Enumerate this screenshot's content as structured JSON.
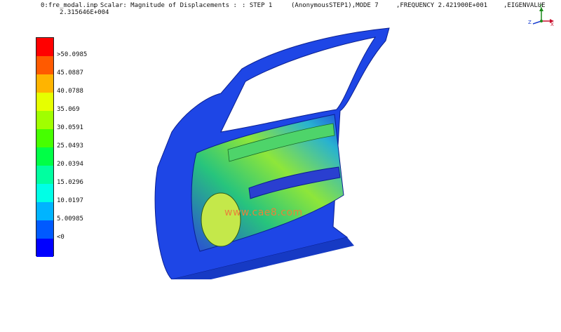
{
  "header": {
    "file": "0:fre_modal.inp",
    "scalar": ": Scalar: Magnitude of Displacements :",
    "step": ": STEP 1",
    "step_name": "(AnonymousSTEP1),MODE 7",
    "frequency": ",FREQUENCY 2.421900E+001",
    "eigenvalue_label": ",EIGENVALUE",
    "eigenvalue_value": "2.315646E+004"
  },
  "legend": {
    "labels": [
      ">50.0985",
      "45.0887",
      "40.0788",
      "35.069",
      "30.0591",
      "25.0493",
      "20.0394",
      "15.0296",
      "10.0197",
      "5.00985",
      "<0"
    ],
    "colors": [
      "#ff0000",
      "#ff5a00",
      "#ffb400",
      "#e6ff00",
      "#a0ff00",
      "#46ff00",
      "#00ff46",
      "#00ffa0",
      "#00ffe6",
      "#00b4ff",
      "#005aff",
      "#0000ff"
    ]
  },
  "triad": {
    "x_label": "X",
    "y_label": "Y",
    "z_label": "Z"
  },
  "watermark": {
    "text": "www.cae8.com"
  }
}
